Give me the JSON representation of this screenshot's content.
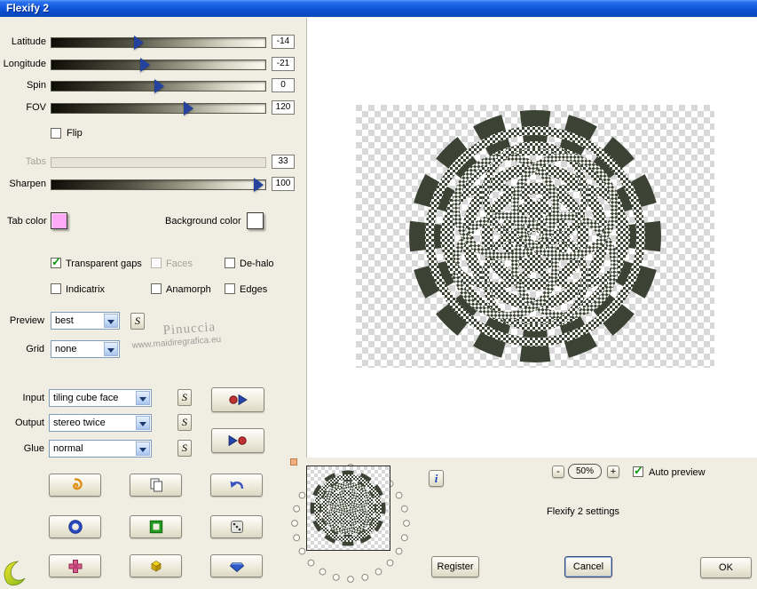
{
  "window": {
    "title": "Flexify 2"
  },
  "sliders": [
    {
      "label": "Latitude",
      "value": "-14"
    },
    {
      "label": "Longitude",
      "value": "-21"
    },
    {
      "label": "Spin",
      "value": "0"
    },
    {
      "label": "FOV",
      "value": "120"
    },
    {
      "label": "Tabs",
      "value": "33"
    },
    {
      "label": "Sharpen",
      "value": "100"
    }
  ],
  "checkboxes": {
    "flip": {
      "label": "Flip",
      "checked": false
    },
    "transparent_gaps": {
      "label": "Transparent gaps",
      "checked": true
    },
    "faces": {
      "label": "Faces",
      "checked": false
    },
    "de_halo": {
      "label": "De-halo",
      "checked": false
    },
    "indicatrix": {
      "label": "Indicatrix",
      "checked": false
    },
    "anamorph": {
      "label": "Anamorph",
      "checked": false
    },
    "edges": {
      "label": "Edges",
      "checked": false
    },
    "auto_preview": {
      "label": "Auto preview",
      "checked": true
    }
  },
  "color_pickers": {
    "tab_color": {
      "label": "Tab color",
      "color": "#ffaaf6"
    },
    "background_color": {
      "label": "Background color",
      "color": "#ffffff"
    }
  },
  "dropdowns": {
    "preview": {
      "label": "Preview",
      "value": "best"
    },
    "grid": {
      "label": "Grid",
      "value": "none"
    },
    "input": {
      "label": "Input",
      "value": "tiling cube face"
    },
    "output": {
      "label": "Output",
      "value": "stereo twice"
    },
    "glue": {
      "label": "Glue",
      "value": "normal"
    }
  },
  "s_button_label": "S",
  "watermark": {
    "line1": "Pinuccia",
    "line2": "www.maidiregrafica.eu"
  },
  "bottom": {
    "info_label": "i",
    "zoom_out": "-",
    "zoom_level": "50%",
    "zoom_in": "+",
    "settings_text": "Flexify 2 settings",
    "register": "Register",
    "cancel": "Cancel",
    "ok": "OK"
  },
  "pattern_colors": {
    "dark_olive": "#3c4334",
    "checker_gray": "#d8d8d8"
  }
}
